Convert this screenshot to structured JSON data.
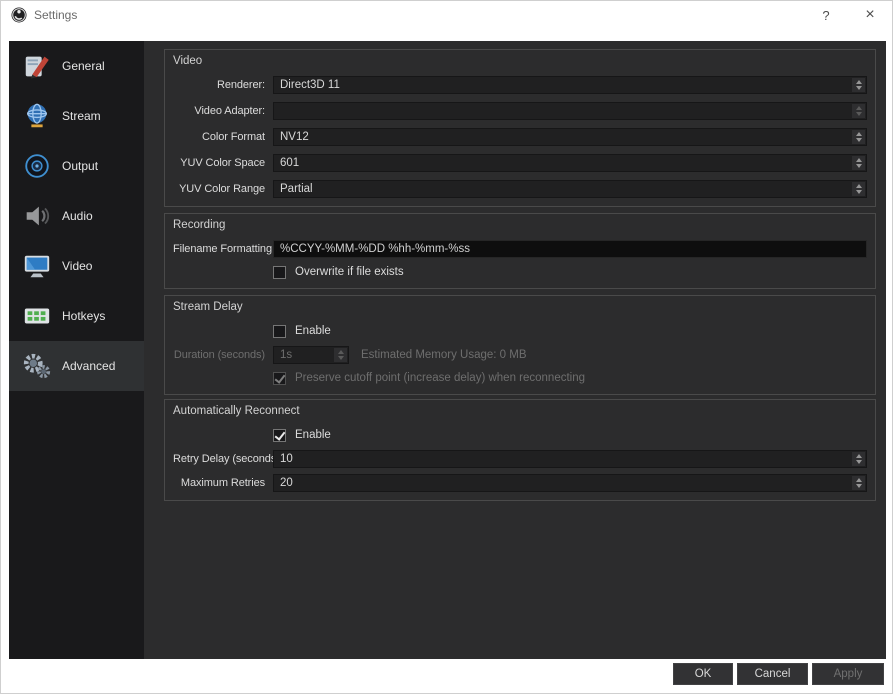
{
  "window": {
    "title": "Settings",
    "help_label": "?",
    "close_label": "×"
  },
  "sidebar": {
    "items": [
      {
        "label": "General"
      },
      {
        "label": "Stream"
      },
      {
        "label": "Output"
      },
      {
        "label": "Audio"
      },
      {
        "label": "Video"
      },
      {
        "label": "Hotkeys"
      },
      {
        "label": "Advanced",
        "selected": true
      }
    ]
  },
  "groups": {
    "video": {
      "title": "Video",
      "fields": [
        {
          "label": "Renderer:",
          "value": "Direct3D 11"
        },
        {
          "label": "Video Adapter:",
          "value": ""
        },
        {
          "label": "Color Format",
          "value": "NV12"
        },
        {
          "label": "YUV Color Space",
          "value": "601"
        },
        {
          "label": "YUV Color Range",
          "value": "Partial"
        }
      ]
    },
    "recording": {
      "title": "Recording",
      "filename_label": "Filename Formatting",
      "filename_value": "%CCYY-%MM-%DD %hh-%mm-%ss",
      "overwrite_label": "Overwrite if file exists",
      "overwrite_checked": false
    },
    "stream_delay": {
      "title": "Stream Delay",
      "enable_label": "Enable",
      "enable_checked": false,
      "duration_label": "Duration (seconds)",
      "duration_value": "1s",
      "memory_label": "Estimated Memory Usage: 0 MB",
      "preserve_label": "Preserve cutoff point (increase delay) when reconnecting",
      "preserve_checked": true
    },
    "reconnect": {
      "title": "Automatically Reconnect",
      "enable_label": "Enable",
      "enable_checked": true,
      "retry_label": "Retry Delay (seconds)",
      "retry_value": "10",
      "max_label": "Maximum Retries",
      "max_value": "20"
    }
  },
  "footer": {
    "ok_label": "OK",
    "cancel_label": "Cancel",
    "apply_label": "Apply"
  },
  "colors": {
    "titlebar_bg": "#ffffff",
    "sidebar_bg": "#19191b",
    "pane_bg": "#2c2c2d",
    "selected_item_bg": "#2f3133",
    "input_bg": "#202021",
    "text_light": "#dcdcdc",
    "text_disabled": "#6e6e6e",
    "accent_blue": "#2e7cc4"
  }
}
